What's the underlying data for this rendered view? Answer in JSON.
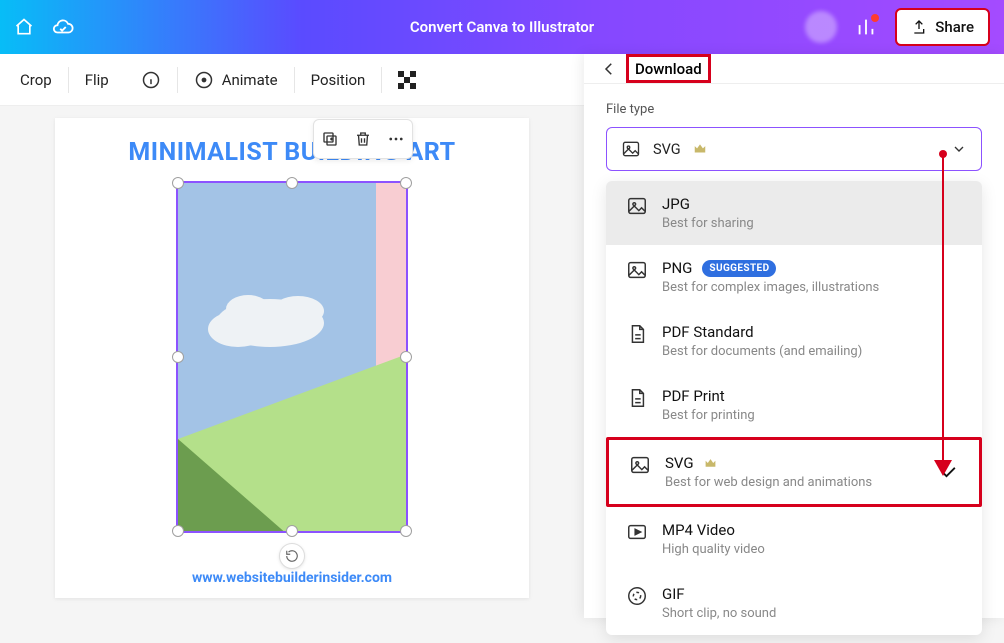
{
  "header": {
    "title": "Convert Canva to Illustrator",
    "share_label": "Share"
  },
  "toolbar": {
    "crop": "Crop",
    "flip": "Flip",
    "animate": "Animate",
    "position": "Position"
  },
  "canvas": {
    "headline": "MINIMALIST BUILDING ART",
    "watermark": "www.websitebuilderinsider.com"
  },
  "panel": {
    "title": "Download",
    "file_type_label": "File type",
    "selected": "SVG",
    "suggested_badge": "SUGGESTED",
    "options": [
      {
        "key": "jpg",
        "name": "JPG",
        "desc": "Best for sharing",
        "icon": "image",
        "hovered": true
      },
      {
        "key": "png",
        "name": "PNG",
        "desc": "Best for complex images, illustrations",
        "icon": "image",
        "suggested": true
      },
      {
        "key": "pdf_std",
        "name": "PDF Standard",
        "desc": "Best for documents (and emailing)",
        "icon": "pdf"
      },
      {
        "key": "pdf_print",
        "name": "PDF Print",
        "desc": "Best for printing",
        "icon": "pdf"
      },
      {
        "key": "svg",
        "name": "SVG",
        "desc": "Best for web design and animations",
        "icon": "image",
        "crown": true,
        "checked": true,
        "highlight": true
      },
      {
        "key": "mp4",
        "name": "MP4 Video",
        "desc": "High quality video",
        "icon": "video"
      },
      {
        "key": "gif",
        "name": "GIF",
        "desc": "Short clip, no sound",
        "icon": "gif"
      }
    ]
  }
}
